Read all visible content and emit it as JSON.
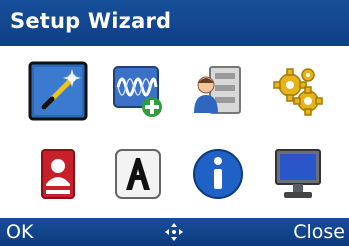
{
  "title": "Setup Wizard",
  "softkeys": {
    "left": "OK",
    "center_icon": "navigation-arrows-icon",
    "right": "Close"
  },
  "icons": [
    "wizard-wand-icon",
    "waveform-add-icon",
    "user-directory-icon",
    "gears-icon",
    "contact-card-icon",
    "font-letter-a-icon",
    "info-icon",
    "monitor-icon"
  ],
  "colors": {
    "bar": "#174f9a",
    "selected": "#1f5fb0"
  }
}
